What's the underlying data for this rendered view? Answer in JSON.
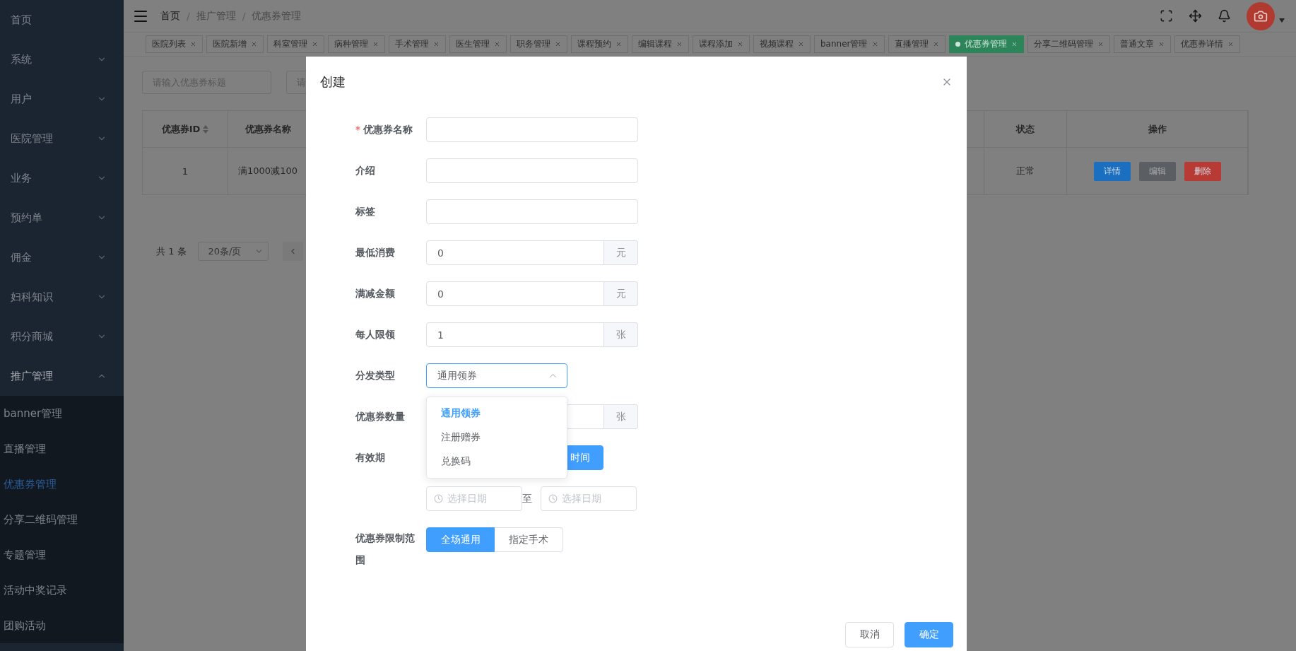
{
  "sidebar": {
    "items": [
      {
        "kind": "link",
        "label": "首页"
      },
      {
        "kind": "menu",
        "label": "系统",
        "expanded": false
      },
      {
        "kind": "menu",
        "label": "用户",
        "expanded": false
      },
      {
        "kind": "menu",
        "label": "医院管理",
        "expanded": false
      },
      {
        "kind": "menu",
        "label": "业务",
        "expanded": false
      },
      {
        "kind": "menu",
        "label": "预约单",
        "expanded": false
      },
      {
        "kind": "menu",
        "label": "佣金",
        "expanded": false
      },
      {
        "kind": "menu",
        "label": "妇科知识",
        "expanded": false
      },
      {
        "kind": "menu",
        "label": "积分商城",
        "expanded": false
      },
      {
        "kind": "menu",
        "label": "推广管理",
        "expanded": true,
        "children": [
          {
            "label": "banner管理",
            "selected": false
          },
          {
            "label": "直播管理",
            "selected": false
          },
          {
            "label": "优惠券管理",
            "selected": true
          },
          {
            "label": "分享二维码管理",
            "selected": false
          },
          {
            "label": "专题管理",
            "selected": false
          },
          {
            "label": "活动中奖记录",
            "selected": false
          },
          {
            "label": "团购活动",
            "selected": false
          }
        ]
      }
    ]
  },
  "header": {
    "breadcrumb": [
      "首页",
      "推广管理",
      "优惠券管理"
    ],
    "separator": "/"
  },
  "tags": [
    {
      "label": "医院列表",
      "active": false
    },
    {
      "label": "医院新增",
      "active": false
    },
    {
      "label": "科室管理",
      "active": false
    },
    {
      "label": "病种管理",
      "active": false
    },
    {
      "label": "手术管理",
      "active": false
    },
    {
      "label": "医生管理",
      "active": false
    },
    {
      "label": "职务管理",
      "active": false
    },
    {
      "label": "课程预约",
      "active": false
    },
    {
      "label": "编辑课程",
      "active": false
    },
    {
      "label": "课程添加",
      "active": false
    },
    {
      "label": "视频课程",
      "active": false
    },
    {
      "label": "banner管理",
      "active": false
    },
    {
      "label": "直播管理",
      "active": false
    },
    {
      "label": "优惠券管理",
      "active": true
    },
    {
      "label": "分享二维码管理",
      "active": false
    },
    {
      "label": "普通文章",
      "active": false
    },
    {
      "label": "优惠券详情",
      "active": false
    }
  ],
  "filters": {
    "placeholders": [
      "请输入优惠券标题",
      "请"
    ]
  },
  "table": {
    "columns": [
      "优惠券ID",
      "优惠券名称",
      "状态",
      "操作"
    ],
    "rows": [
      {
        "cells": [
          "1",
          "满1000减100",
          "正常"
        ],
        "actions": [
          {
            "kind": "info",
            "label": "详情"
          },
          {
            "kind": "edit",
            "label": "编辑"
          },
          {
            "kind": "delete",
            "label": "删除"
          }
        ]
      }
    ]
  },
  "pagination": {
    "total": "共 1 条",
    "page_size": "20条/页"
  },
  "dialog": {
    "title": "创建",
    "fields": [
      {
        "kind": "text",
        "label": "优惠券名称",
        "required_mark": "*"
      },
      {
        "kind": "text",
        "label": "介绍"
      },
      {
        "kind": "text",
        "label": "标签"
      },
      {
        "kind": "append",
        "label": "最低消费",
        "value": "0",
        "unit": "元"
      },
      {
        "kind": "append",
        "label": "满减金额",
        "value": "0",
        "unit": "元"
      },
      {
        "kind": "append",
        "label": "每人限领",
        "value": "1",
        "unit": "张"
      },
      {
        "kind": "select",
        "label": "分发类型",
        "value": "通用领券",
        "open": true,
        "options": [
          {
            "label": "通用领券",
            "selected": true
          },
          {
            "label": "注册赠券",
            "selected": false
          },
          {
            "label": "兑换码",
            "selected": false
          }
        ]
      },
      {
        "kind": "append",
        "label": "优惠券数量",
        "unit": "张"
      },
      {
        "kind": "radio",
        "label": "有效期",
        "options": [
          {
            "label": "时间",
            "selected": true
          }
        ]
      },
      {
        "kind": "daterange",
        "placeholders": [
          "选择日期",
          "选择日期"
        ],
        "separator": "至"
      },
      {
        "kind": "radio",
        "label": "优惠券限制范围",
        "options": [
          {
            "label": "全场通用",
            "selected": true
          },
          {
            "label": "指定手术",
            "selected": false
          }
        ]
      }
    ],
    "footer": [
      {
        "kind": "default",
        "label": "取消"
      },
      {
        "kind": "primary",
        "label": "确定"
      }
    ]
  }
}
